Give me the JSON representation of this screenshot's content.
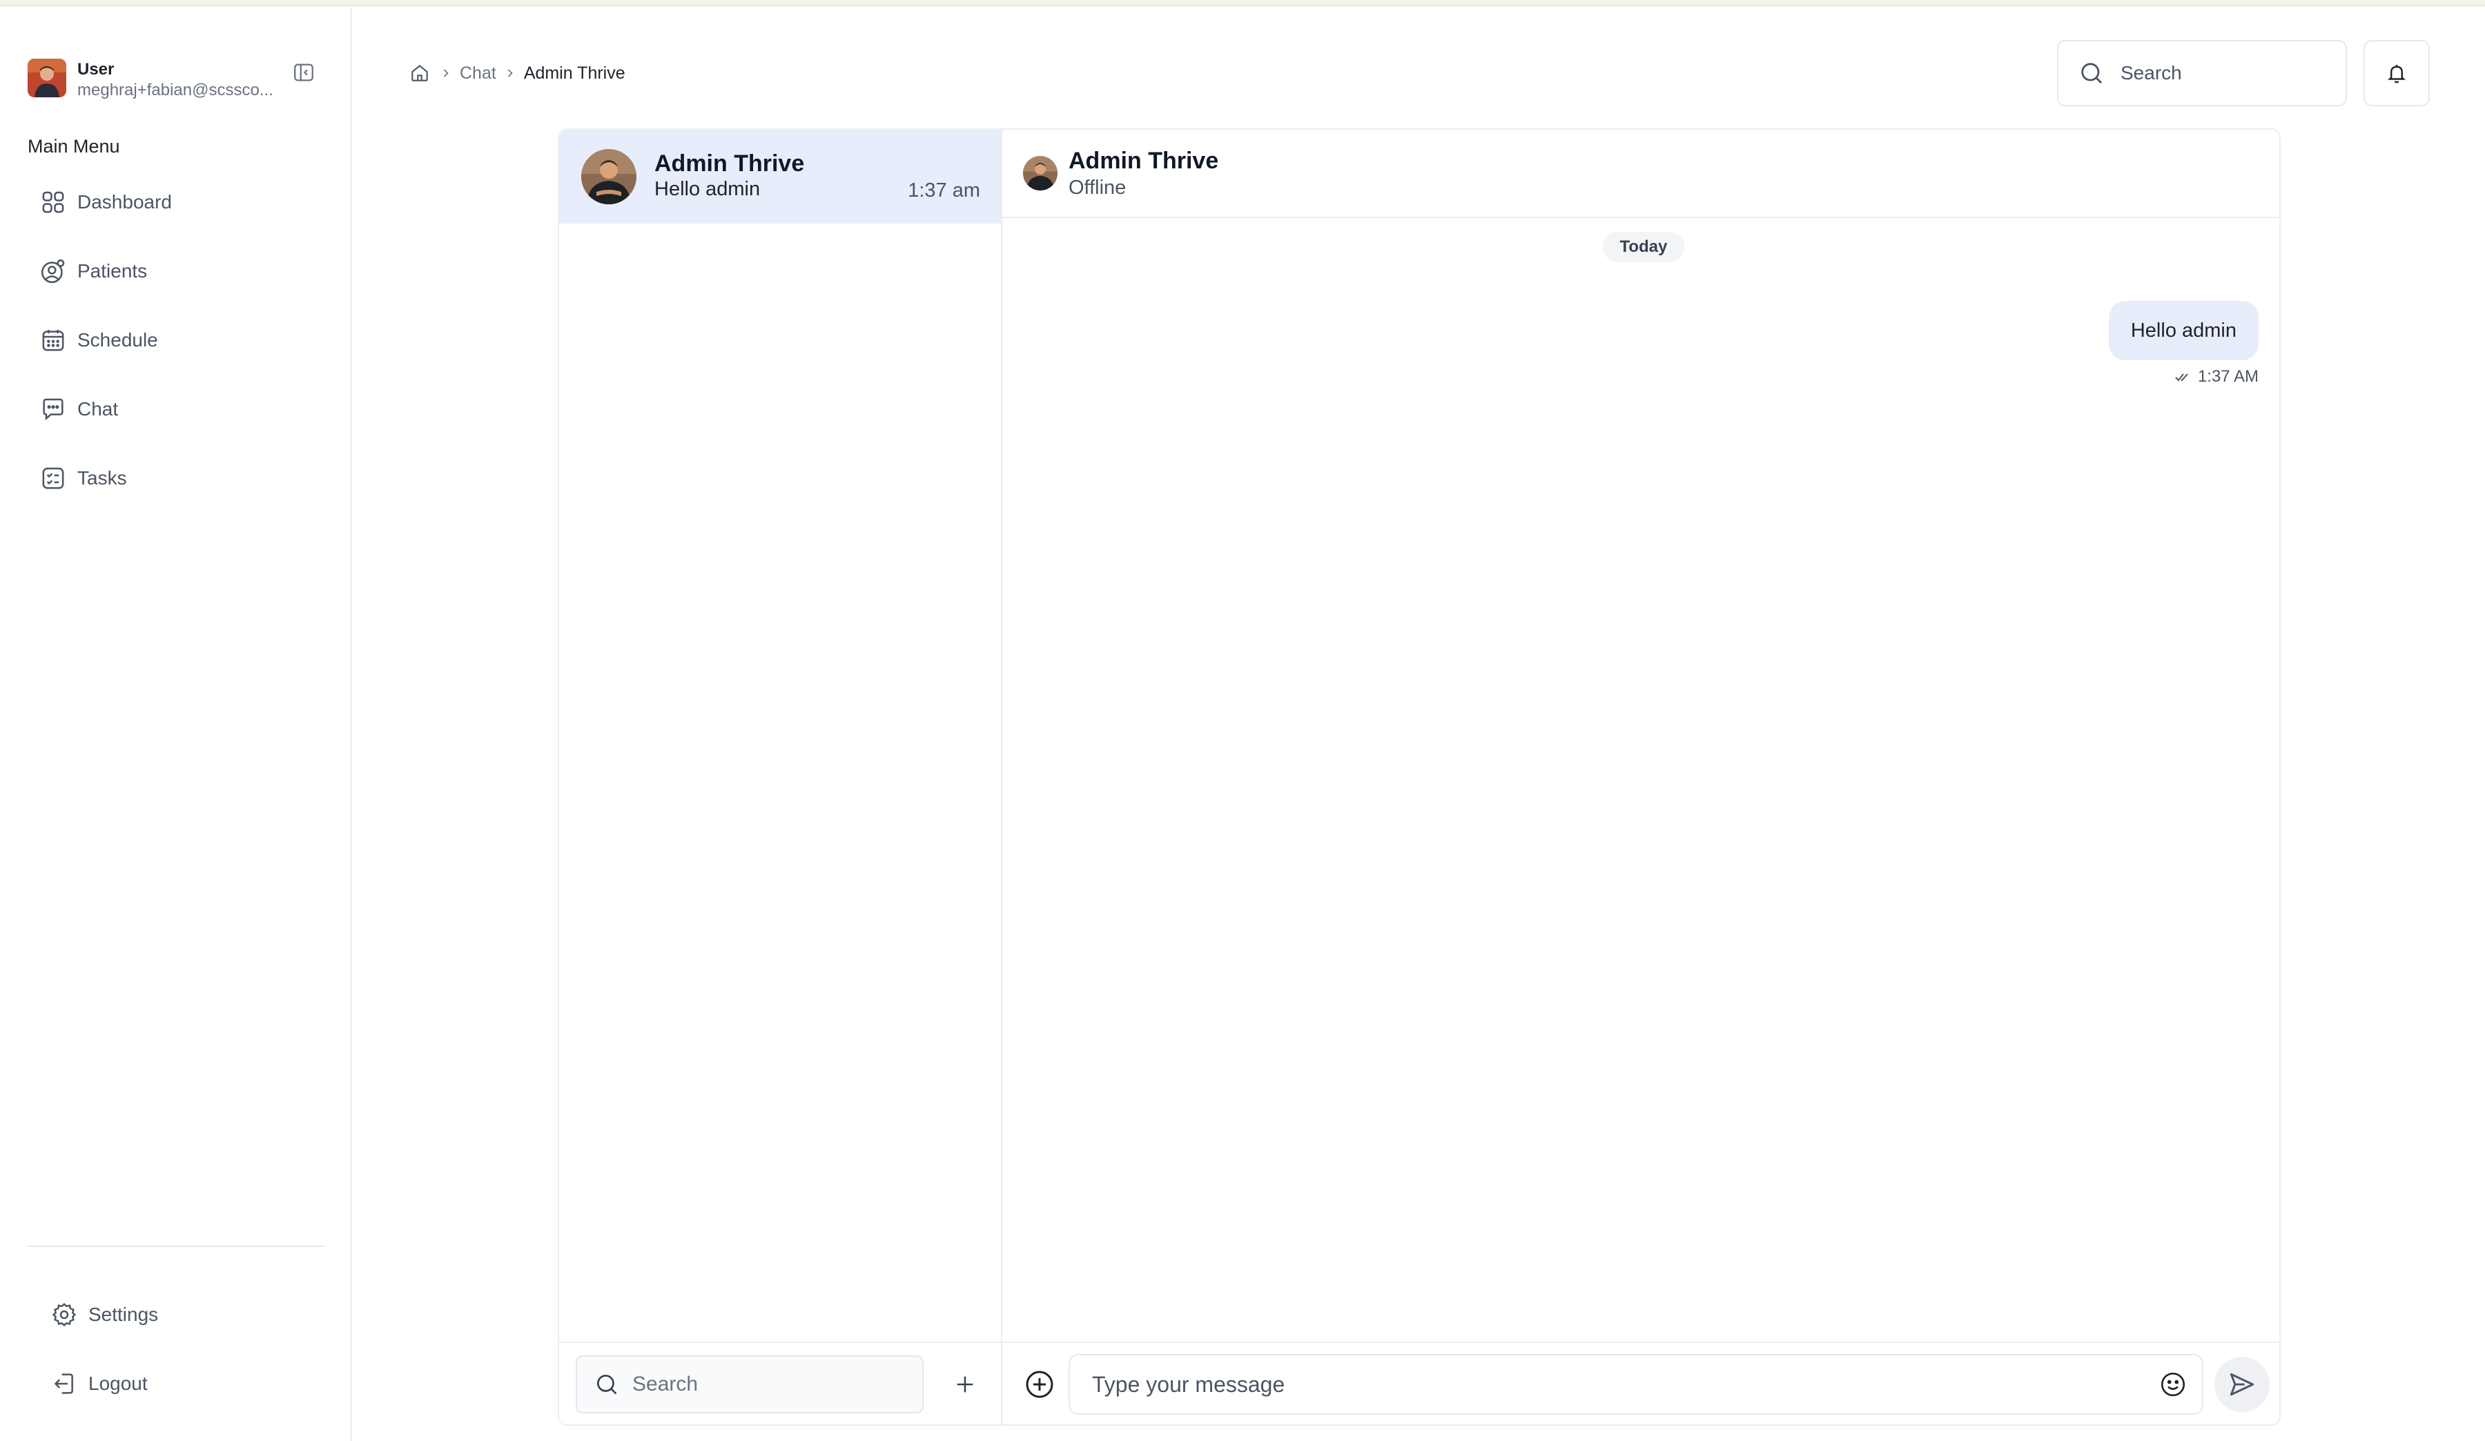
{
  "user": {
    "name": "User",
    "email": "meghraj+fabian@scssco..."
  },
  "sidebar": {
    "menu_title": "Main Menu",
    "items": [
      {
        "label": "Dashboard",
        "icon": "grid-icon"
      },
      {
        "label": "Patients",
        "icon": "user-circle-icon"
      },
      {
        "label": "Schedule",
        "icon": "calendar-icon"
      },
      {
        "label": "Chat",
        "icon": "chat-bubble-icon"
      },
      {
        "label": "Tasks",
        "icon": "checklist-icon"
      }
    ],
    "bottom_items": [
      {
        "label": "Settings",
        "icon": "gear-icon"
      },
      {
        "label": "Logout",
        "icon": "logout-icon"
      }
    ]
  },
  "breadcrumb": {
    "items": [
      "Chat",
      "Admin Thrive"
    ]
  },
  "header": {
    "search_placeholder": "Search"
  },
  "conversations": [
    {
      "name": "Admin Thrive",
      "preview": "Hello admin",
      "time": "1:37 am",
      "selected": true
    }
  ],
  "conversation_search": {
    "placeholder": "Search"
  },
  "thread": {
    "name": "Admin Thrive",
    "status": "Offline",
    "day_label": "Today",
    "messages": [
      {
        "text": "Hello admin",
        "time": "1:37 AM",
        "outgoing": true
      }
    ],
    "composer_placeholder": "Type your message"
  },
  "colors": {
    "selected_bg": "#e8edfb",
    "border": "#e5e7eb",
    "muted_text": "#6b7280"
  }
}
